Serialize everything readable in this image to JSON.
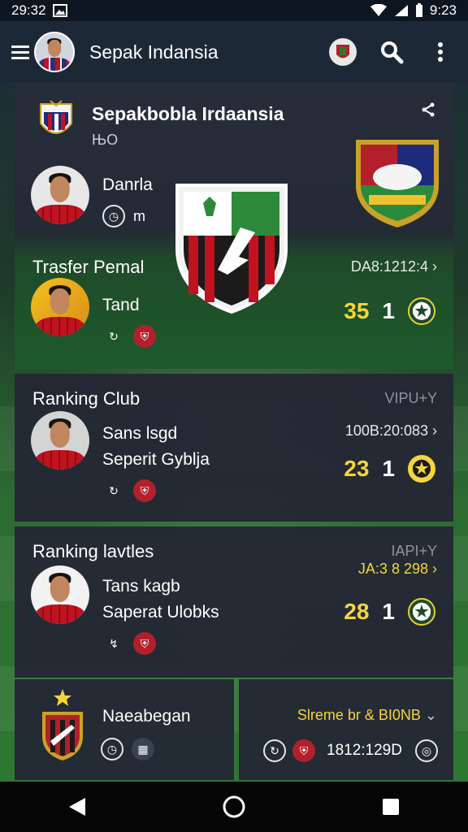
{
  "status": {
    "time": "29:32",
    "right_time": "9:23"
  },
  "app": {
    "title": "Sepak Indansia"
  },
  "hero": {
    "title": "Sepakbobla Irdaansia",
    "subtitle": "ЊО",
    "player_name": "Danrla",
    "section_label": "Trasfer Pemal",
    "player2_name": "Tand",
    "date": "DA8:1212:4",
    "score_home": "35",
    "score_away": "1"
  },
  "ranking_club": {
    "label": "Ranking Club",
    "tag": "VIPU+Y",
    "line1": "Sans lsgd",
    "line2": "Seperit Gyblja",
    "date": "100B:20:083",
    "score_home": "23",
    "score_away": "1"
  },
  "ranking_lavtles": {
    "label": "Ranking lavtles",
    "tag": "IAPI+Y",
    "line1": "Tans kagb",
    "line2": "Saperat Ulobks",
    "date": "JA:3 8 298",
    "score_home": "28",
    "score_away": "1"
  },
  "bottom_left": {
    "name": "Naeabegan"
  },
  "bottom_right": {
    "label": "Slreme br & BI0NB",
    "date": "1812:129D"
  },
  "colors": {
    "accent_yellow": "#f6d53b",
    "card_bg": "#232834",
    "appbar_bg": "#1d2837"
  }
}
